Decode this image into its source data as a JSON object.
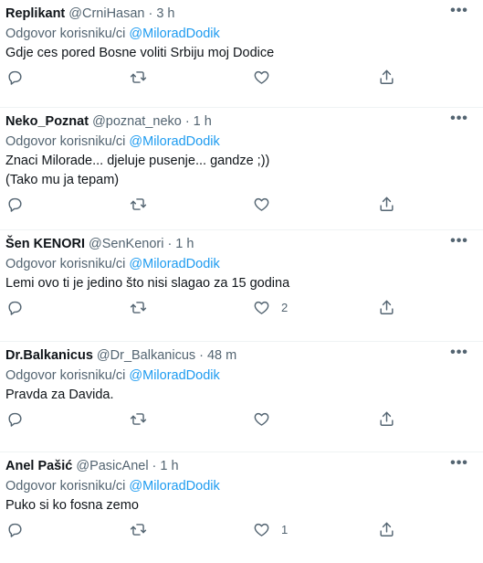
{
  "tweets": [
    {
      "name": "Replikant",
      "handle": "@CrniHasan",
      "dot": "·",
      "time": "3 h",
      "reply_prefix": "Odgovor korisniku/ci",
      "reply_mention": "@MiloradDodik",
      "text": "Gdje ces pored Bosne voliti Srbiju moj Dodice",
      "likes": ""
    },
    {
      "name": "Neko_Poznat",
      "handle": "@poznat_neko",
      "dot": "·",
      "time": "1 h",
      "reply_prefix": "Odgovor korisniku/ci",
      "reply_mention": "@MiloradDodik",
      "text": "Znaci Milorade... djeluje pusenje... gandze ;))\n(Tako mu ja tepam)",
      "likes": ""
    },
    {
      "name": "Šen KENORI",
      "handle": "@SenKenori",
      "dot": "·",
      "time": "1 h",
      "reply_prefix": "Odgovor korisniku/ci",
      "reply_mention": "@MiloradDodik",
      "text": "Lemi ovo ti je jedino što nisi slagao za 15 godina",
      "likes": "2"
    },
    {
      "name": "Dr.Balkanicus",
      "handle": "@Dr_Balkanicus",
      "dot": "·",
      "time": "48 m",
      "reply_prefix": "Odgovor korisniku/ci",
      "reply_mention": "@MiloradDodik",
      "text": "Pravda za Davida.",
      "likes": ""
    },
    {
      "name": "Anel Pašić",
      "handle": "@PasicAnel",
      "dot": "·",
      "time": "1 h",
      "reply_prefix": "Odgovor korisniku/ci",
      "reply_mention": "@MiloradDodik",
      "text": "Puko si ko fosna zemo",
      "likes": "1"
    }
  ],
  "more_label": "•••",
  "icons": {
    "reply": "reply-icon",
    "retweet": "retweet-icon",
    "like": "heart-icon",
    "share": "share-icon"
  },
  "colors": {
    "link": "#1d9bf0",
    "muted": "#536471",
    "text": "#0f1419",
    "divider": "#eff3f4"
  }
}
